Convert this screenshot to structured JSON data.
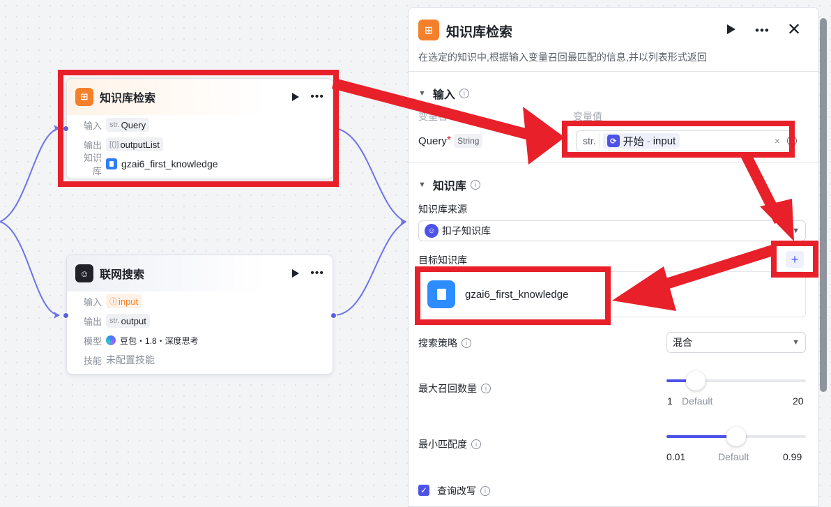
{
  "kb_node": {
    "title": "知识库检索",
    "input_label": "输入",
    "input_type": "str.",
    "input_value": "Query",
    "output_label": "输出",
    "output_type": "[()]",
    "output_value": "outputList",
    "kb_label": "知识库",
    "kb_value": "gzai6_first_knowledge"
  },
  "web_node": {
    "title": "联网搜索",
    "input_label": "输入",
    "input_value": "input",
    "output_label": "输出",
    "output_type": "str.",
    "output_value": "output",
    "model_label": "模型",
    "model_value": "豆包・1.8・深度思考",
    "skill_label": "技能",
    "skill_value": "未配置技能"
  },
  "panel": {
    "title": "知识库检索",
    "description": "在选定的知识中,根据输入变量召回最匹配的信息,并以列表形式返回",
    "input_section": {
      "title": "输入",
      "col_name": "变量名",
      "col_value": "变量值",
      "var_name": "Query",
      "required_mark": "*",
      "var_type": "String",
      "ref_type": "str.",
      "ref_source": "开始",
      "ref_sep": "-",
      "ref_var": "input",
      "clear": "×"
    },
    "kb_section": {
      "title": "知识库",
      "source_label": "知识库来源",
      "source_value": "扣子知识库",
      "target_label": "目标知识库",
      "target_name": "gzai6_first_knowledge",
      "add": "+"
    },
    "strategy": {
      "label": "搜索策略",
      "value": "混合"
    },
    "max_recall": {
      "label": "最大召回数量",
      "min": "1",
      "default_label": "Default",
      "max": "20",
      "fraction": 0.21
    },
    "min_match": {
      "label": "最小匹配度",
      "min": "0.01",
      "default_label": "Default",
      "max": "0.99",
      "fraction": 0.5
    },
    "rewrite": {
      "label": "查询改写",
      "checked": true
    }
  },
  "colors": {
    "accent": "#4d53e8",
    "annotation": "#e8202a",
    "kb_orange": "#f5802b"
  }
}
